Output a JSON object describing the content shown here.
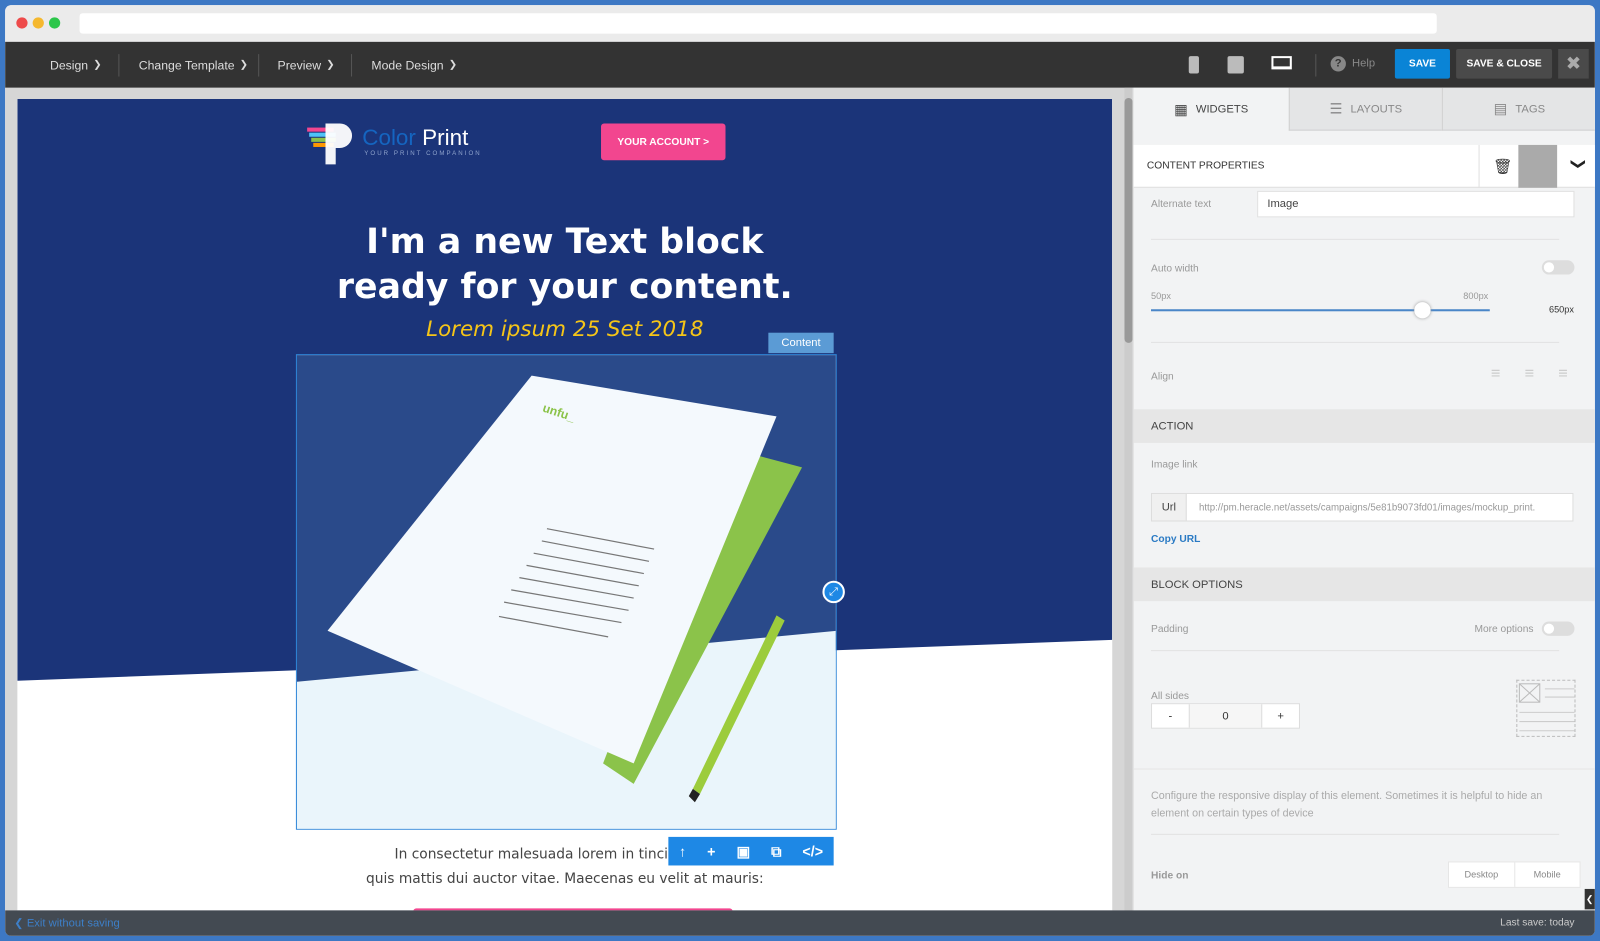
{
  "topbar": {
    "menus": [
      "Design",
      "Change Template",
      "Preview",
      "Mode Design"
    ],
    "help": "Help",
    "save": "SAVE",
    "save_close": "SAVE & CLOSE"
  },
  "email": {
    "brand_left": "Color",
    "brand_right": "Print",
    "tagline": "YOUR PRINT COMPANION",
    "account_button": "YOUR ACCOUNT >",
    "headline_1": "I'm a new Text block",
    "headline_2": "ready for your content.",
    "subheadline": "Lorem ipsum 25 Set 2018",
    "content_label": "Content",
    "body_1": "In consectetur malesuada lorem in tincidunt. Lett",
    "body_2": "quis mattis dui auctor vitae. Maecenas eu velit at mauris:",
    "paper_logo": "unfu_"
  },
  "colors": {
    "accent": "#0a84d6",
    "hero": "#1b3479",
    "pink": "#f2468f",
    "yellow": "#f5c518"
  },
  "panel": {
    "tabs": [
      "WIDGETS",
      "LAYOUTS",
      "TAGS"
    ],
    "active_tab": "WIDGETS",
    "content_properties": "CONTENT PROPERTIES",
    "alt_text_label": "Alternate text",
    "alt_text_value": "Image",
    "auto_width_label": "Auto width",
    "auto_width_on": false,
    "slider_min": "50px",
    "slider_max": "800px",
    "slider_value": "650px",
    "slider_fraction": 0.8,
    "align_label": "Align",
    "action_title": "ACTION",
    "image_link_label": "Image link",
    "url_prefix": "Url",
    "url_value": "http://pm.heracle.net/assets/campaigns/5e81b9073fd01/images/mockup_print.",
    "copy_url": "Copy URL",
    "block_options_title": "BLOCK OPTIONS",
    "padding_label": "Padding",
    "more_options": "More options",
    "all_sides_label": "All sides",
    "minus": "-",
    "padding_value": "0",
    "plus": "+",
    "responsive_text": "Configure the responsive display of this element. Sometimes it is helpful to hide an element on certain types of device",
    "hide_on_label": "Hide on",
    "hide_desktop": "Desktop",
    "hide_mobile": "Mobile"
  },
  "footer": {
    "exit": "Exit without saving",
    "last_save": "Last save: today"
  }
}
